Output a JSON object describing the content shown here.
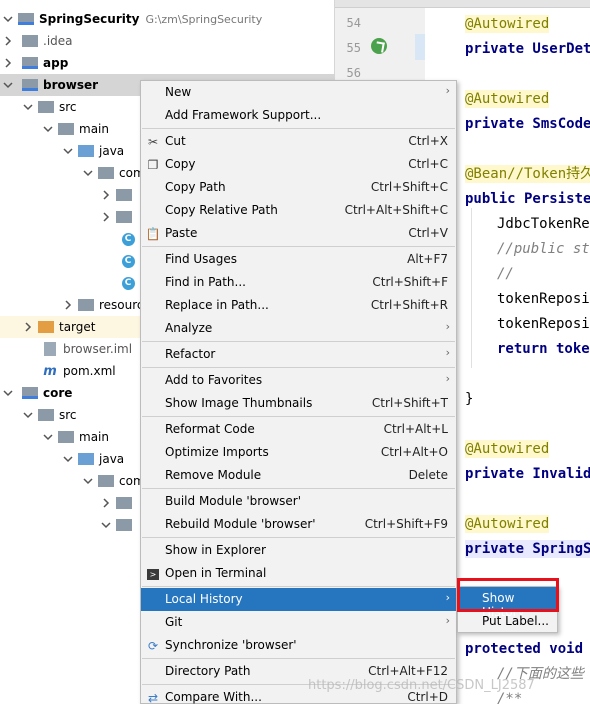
{
  "project_tree": {
    "root_name": "SpringSecurity",
    "root_path": "G:\\zm\\SpringSecurity",
    "items": [
      {
        "label": ".idea"
      },
      {
        "label": "app"
      },
      {
        "label": "browser"
      },
      {
        "label": "src"
      },
      {
        "label": "main"
      },
      {
        "label": "java"
      },
      {
        "label": "com"
      },
      {
        "label": ""
      },
      {
        "label": ""
      },
      {
        "label": ""
      },
      {
        "label": ""
      },
      {
        "label": ""
      },
      {
        "label": "resources"
      },
      {
        "label": "target"
      },
      {
        "label": "browser.iml"
      },
      {
        "label": "pom.xml"
      },
      {
        "label": "core"
      },
      {
        "label": "src"
      },
      {
        "label": "main"
      },
      {
        "label": "java"
      },
      {
        "label": "com"
      },
      {
        "label": ""
      },
      {
        "label": ""
      }
    ]
  },
  "editor": {
    "line_numbers": [
      "54",
      "55",
      "56"
    ],
    "code_lines": [
      "@Autowired",
      "private UserDeta",
      "@Autowired",
      "private SmsCode",
      "@Bean//Token持久",
      "public Persister",
      "JdbcTokenRep",
      "//public sta",
      "//",
      "tokenReposit",
      "tokenReposit",
      "return token",
      "}",
      "@Autowired",
      "private InvalidS",
      "@Autowired",
      "private SpringSe",
      "protected void c",
      "//下面的这些",
      "/**"
    ]
  },
  "context_menu": {
    "items": [
      {
        "label": "New",
        "shortcut": "",
        "submenu": true,
        "icon": ""
      },
      {
        "label": "Add Framework Support...",
        "shortcut": "",
        "submenu": false,
        "icon": ""
      },
      {
        "label": "Cut",
        "shortcut": "Ctrl+X",
        "submenu": false,
        "icon": "scissors-icon"
      },
      {
        "label": "Copy",
        "shortcut": "Ctrl+C",
        "submenu": false,
        "icon": "copy-icon"
      },
      {
        "label": "Copy Path",
        "shortcut": "Ctrl+Shift+C",
        "submenu": false,
        "icon": ""
      },
      {
        "label": "Copy Relative Path",
        "shortcut": "Ctrl+Alt+Shift+C",
        "submenu": false,
        "icon": ""
      },
      {
        "label": "Paste",
        "shortcut": "Ctrl+V",
        "submenu": false,
        "icon": "paste-icon"
      },
      {
        "label": "Find Usages",
        "shortcut": "Alt+F7",
        "submenu": false,
        "icon": ""
      },
      {
        "label": "Find in Path...",
        "shortcut": "Ctrl+Shift+F",
        "submenu": false,
        "icon": ""
      },
      {
        "label": "Replace in Path...",
        "shortcut": "Ctrl+Shift+R",
        "submenu": false,
        "icon": ""
      },
      {
        "label": "Analyze",
        "shortcut": "",
        "submenu": true,
        "icon": ""
      },
      {
        "label": "Refactor",
        "shortcut": "",
        "submenu": true,
        "icon": ""
      },
      {
        "label": "Add to Favorites",
        "shortcut": "",
        "submenu": true,
        "icon": ""
      },
      {
        "label": "Show Image Thumbnails",
        "shortcut": "Ctrl+Shift+T",
        "submenu": false,
        "icon": ""
      },
      {
        "label": "Reformat Code",
        "shortcut": "Ctrl+Alt+L",
        "submenu": false,
        "icon": ""
      },
      {
        "label": "Optimize Imports",
        "shortcut": "Ctrl+Alt+O",
        "submenu": false,
        "icon": ""
      },
      {
        "label": "Remove Module",
        "shortcut": "Delete",
        "submenu": false,
        "icon": ""
      },
      {
        "label": "Build Module 'browser'",
        "shortcut": "",
        "submenu": false,
        "icon": ""
      },
      {
        "label": "Rebuild Module 'browser'",
        "shortcut": "Ctrl+Shift+F9",
        "submenu": false,
        "icon": ""
      },
      {
        "label": "Show in Explorer",
        "shortcut": "",
        "submenu": false,
        "icon": ""
      },
      {
        "label": "Open in Terminal",
        "shortcut": "",
        "submenu": false,
        "icon": "terminal-icon"
      },
      {
        "label": "Local History",
        "shortcut": "",
        "submenu": true,
        "icon": ""
      },
      {
        "label": "Git",
        "shortcut": "",
        "submenu": true,
        "icon": ""
      },
      {
        "label": "Synchronize 'browser'",
        "shortcut": "",
        "submenu": false,
        "icon": "sync-icon"
      },
      {
        "label": "Directory Path",
        "shortcut": "Ctrl+Alt+F12",
        "submenu": false,
        "icon": ""
      },
      {
        "label": "Compare With...",
        "shortcut": "Ctrl+D",
        "submenu": false,
        "icon": "compare-icon"
      }
    ],
    "submenu_arrow": "›"
  },
  "local_history_submenu": {
    "items": [
      {
        "label": "Show History"
      },
      {
        "label": "Put Label..."
      }
    ]
  },
  "watermark": "https://blog.csdn.net/CSDN_LJ2587",
  "colors": {
    "menu_selection": "#2675bf",
    "annotation": "#808000",
    "keyword": "#000080",
    "callout_border": "#e8111b"
  }
}
